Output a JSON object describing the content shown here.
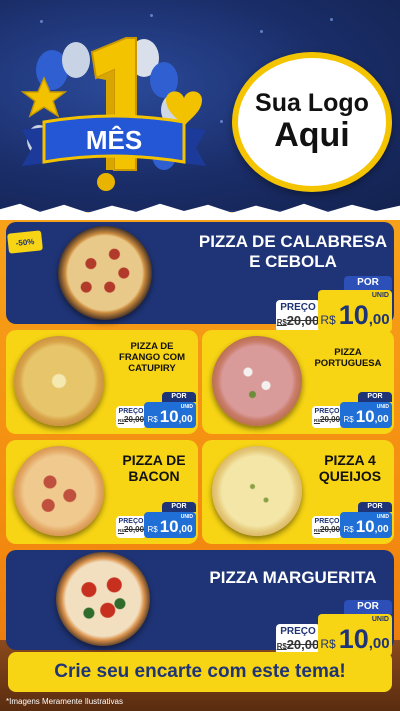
{
  "header": {
    "badge_number": "1",
    "badge_label": "MÊS",
    "logo_line1": "Sua Logo",
    "logo_line2": "Aqui"
  },
  "discount_badge": "-50%",
  "products": [
    {
      "name": "PIZZA DE CALABRESA E CEBOLA",
      "por": "POR",
      "preco_label": "PREÇO",
      "old_prefix": "R$",
      "old_price": "20,00",
      "currency": "R$",
      "price_int": "10",
      "price_dec": ",00",
      "unit": "UNID"
    },
    {
      "name": "PIZZA DE FRANGO COM CATUPIRY",
      "por": "POR",
      "preco_label": "PREÇO",
      "old_prefix": "R$",
      "old_price": "20,00",
      "currency": "R$",
      "price_int": "10",
      "price_dec": ",00",
      "unit": "UNID"
    },
    {
      "name": "PIZZA PORTUGUESA",
      "por": "POR",
      "preco_label": "PREÇO",
      "old_prefix": "R$",
      "old_price": "20,00",
      "currency": "R$",
      "price_int": "10",
      "price_dec": ",00",
      "unit": "UNID"
    },
    {
      "name": "PIZZA DE BACON",
      "por": "POR",
      "preco_label": "PREÇO",
      "old_prefix": "R$",
      "old_price": "20,00",
      "currency": "R$",
      "price_int": "10",
      "price_dec": ",00",
      "unit": "UNID"
    },
    {
      "name": "PIZZA 4 QUEIJOS",
      "por": "POR",
      "preco_label": "PREÇO",
      "old_prefix": "R$",
      "old_price": "20,00",
      "currency": "R$",
      "price_int": "10",
      "price_dec": ",00",
      "unit": "UNID"
    },
    {
      "name": "PIZZA MARGUERITA",
      "por": "POR",
      "preco_label": "PREÇO",
      "old_prefix": "R$",
      "old_price": "20,00",
      "currency": "R$",
      "price_int": "10",
      "price_dec": ",00",
      "unit": "UNID"
    }
  ],
  "footer": {
    "cta": "Crie seu encarte com este tema!",
    "note": "*Imagens Meramente Ilustrativas"
  },
  "colors": {
    "navy": "#1f3476",
    "yellow": "#f7d414",
    "orange": "#f48c10",
    "blue_accent": "#1f6fd6"
  }
}
